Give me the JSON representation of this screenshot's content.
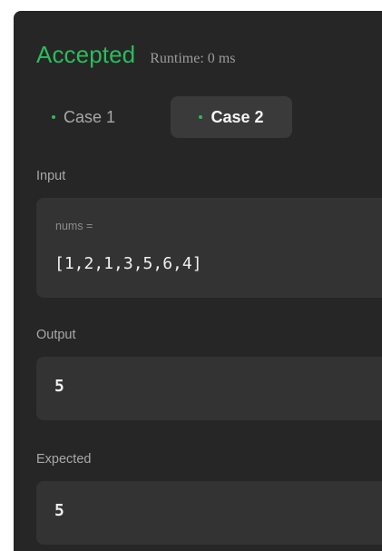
{
  "result": {
    "status": "Accepted",
    "runtime": "Runtime: 0 ms"
  },
  "tabs": [
    {
      "label": "Case 1",
      "selected": false
    },
    {
      "label": "Case 2",
      "selected": true
    }
  ],
  "input": {
    "label": "Input",
    "var_name": "nums =",
    "value": "[1,2,1,3,5,6,4]"
  },
  "output": {
    "label": "Output",
    "value": "5"
  },
  "expected": {
    "label": "Expected",
    "value": "5"
  },
  "colors": {
    "accepted": "#2cbb5d",
    "panel_bg": "#262626",
    "box_bg": "#333333"
  }
}
